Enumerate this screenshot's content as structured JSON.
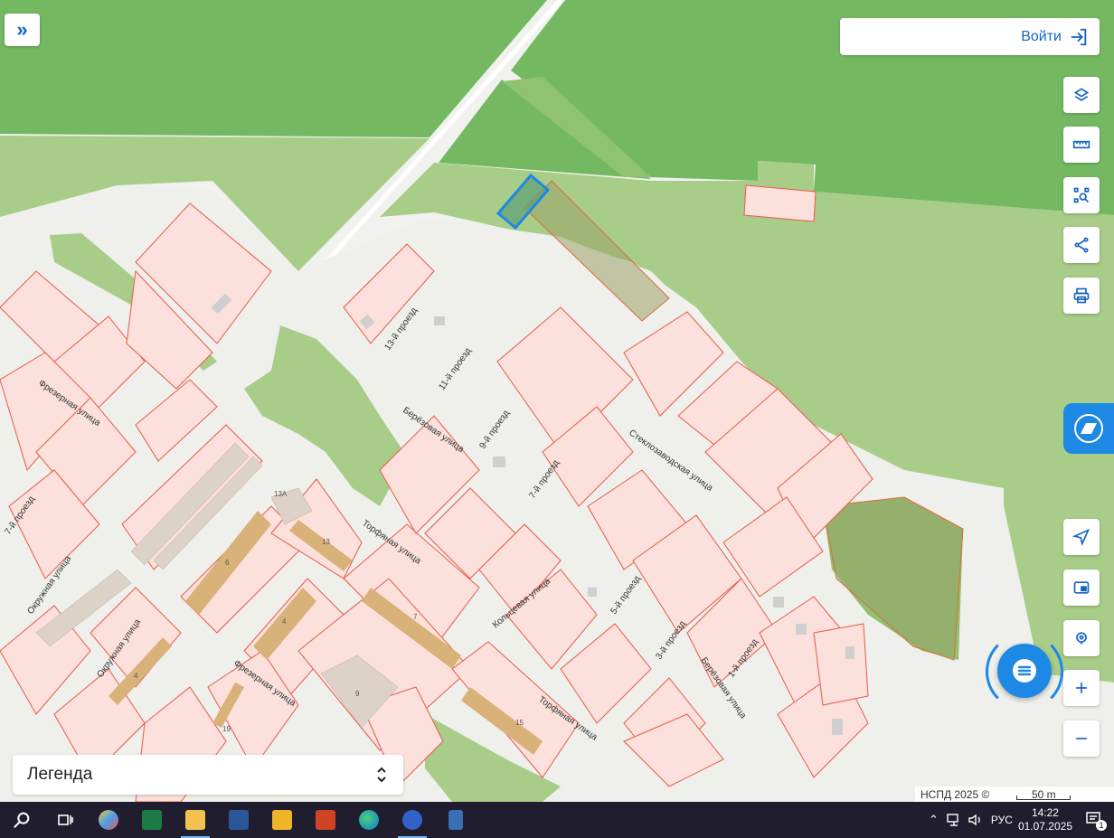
{
  "header": {
    "login_label": "Войти",
    "expand_symbol": "»"
  },
  "toolbar": {
    "buttons": [
      "layers-icon",
      "ruler-icon",
      "select-area-icon",
      "share-icon",
      "print-icon"
    ]
  },
  "map": {
    "streets": [
      "13-й проезд",
      "11-й проезд",
      "9-й проезд",
      "7-й проезд",
      "5-й проезд",
      "3-й проезд",
      "1-й проезд",
      "Берёзовая улица",
      "Берёзовая улица",
      "Стеклозаводская улица",
      "Торфяная улица",
      "Торфяная улица",
      "Кольцевая улица",
      "Фрезерная улица",
      "Фрезерная улица",
      "Окружная улица",
      "Окружная улица",
      "7-й проезд"
    ],
    "numbers": [
      "13А",
      "13",
      "6",
      "4",
      "7",
      "9",
      "15",
      "19",
      "4"
    ]
  },
  "legend": {
    "label": "Легенда"
  },
  "attribution": {
    "text": "НСПД 2025 ©",
    "scale": "50 m"
  },
  "taskbar": {
    "lang": "РУС",
    "time": "14:22",
    "date": "01.07.2025",
    "notification_count": "1"
  },
  "colors": {
    "accent": "#1e88e5",
    "forest": "#74b962",
    "meadow": "#a8cd88",
    "parcel": "#fbe0dc",
    "parcel_border": "#e85a48"
  }
}
